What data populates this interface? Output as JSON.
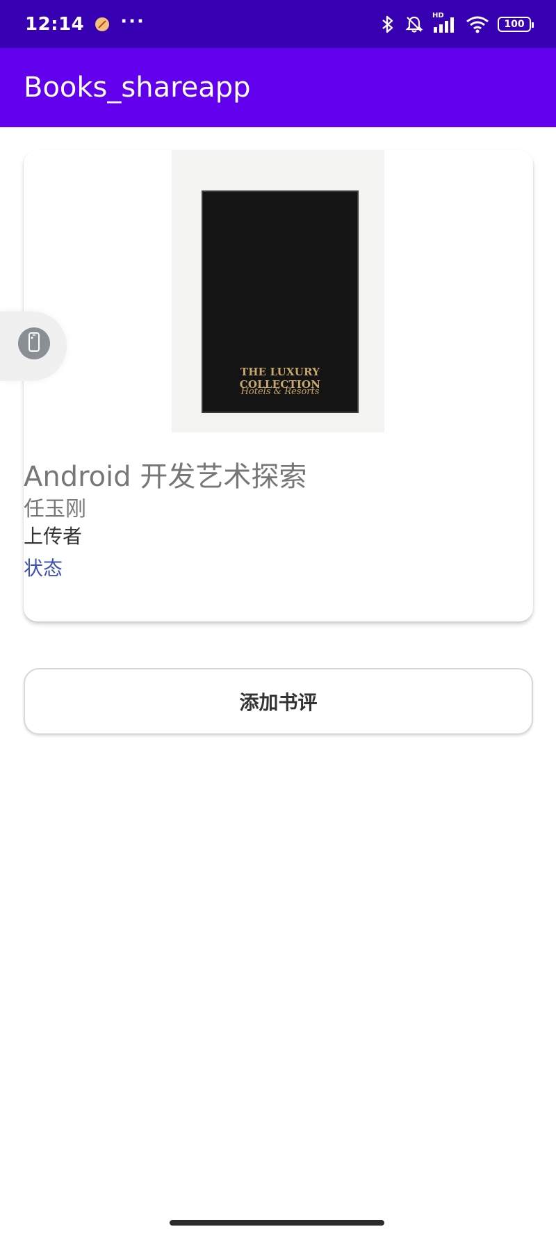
{
  "status_bar": {
    "time": "12:14",
    "more": "···",
    "battery_level": "100",
    "network_label": "HD",
    "icons": [
      "app-notification-icon",
      "bluetooth-icon",
      "silent-bell-icon",
      "cellular-signal-icon",
      "wifi-icon",
      "battery-icon"
    ]
  },
  "app_bar": {
    "title": "Books_shareapp"
  },
  "book": {
    "cover": {
      "line1": "THE LUXURY COLLECTION",
      "line2": "Hotels & Resorts"
    },
    "title": "Android 开发艺术探索",
    "author": "任玉刚",
    "uploader_label": "上传者",
    "status_label": "状态"
  },
  "actions": {
    "add_review_label": "添加书评"
  },
  "colors": {
    "status_bar": "#3700b3",
    "app_bar": "#6200ee",
    "status_text": "#3f51b5",
    "secondary_text": "#777777"
  }
}
